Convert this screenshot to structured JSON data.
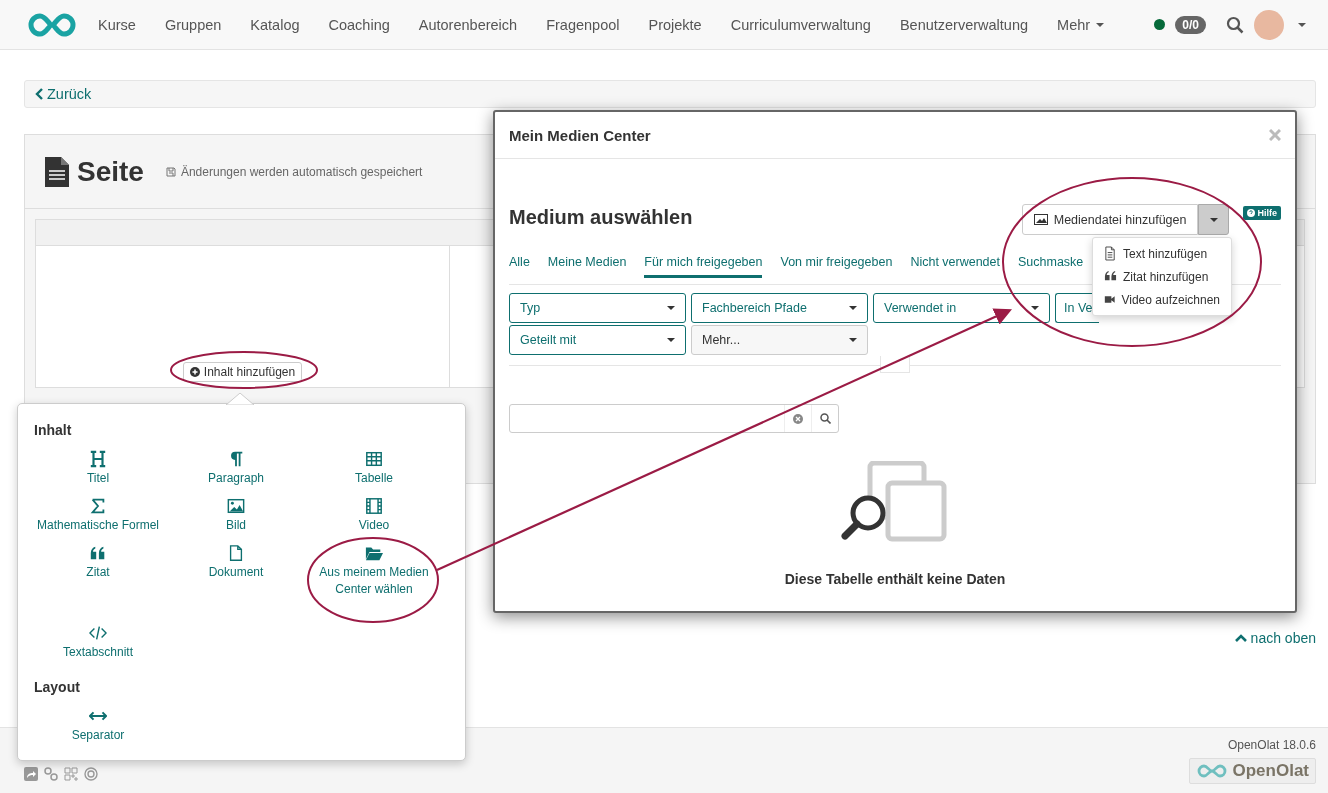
{
  "nav": {
    "items": [
      {
        "label": "Kurse",
        "kind": "link"
      },
      {
        "label": "Gruppen",
        "kind": "link"
      },
      {
        "label": "Katalog",
        "kind": "link"
      },
      {
        "label": "Coaching",
        "kind": "link"
      },
      {
        "label": "Autorenbereich",
        "kind": "link"
      },
      {
        "label": "Fragenpool",
        "kind": "link"
      },
      {
        "label": "Projekte",
        "kind": "link"
      },
      {
        "label": "Curriculumverwaltung",
        "kind": "link"
      },
      {
        "label": "Benutzerverwaltung",
        "kind": "link"
      },
      {
        "label": "Mehr",
        "kind": "menu"
      }
    ],
    "badge": "0/0"
  },
  "back": "Zurück",
  "page": {
    "title": "Seite",
    "autosave": "Änderungen werden automatisch gespeichert",
    "add_button": "Inhalt hinzufügen"
  },
  "popover": {
    "sections": [
      {
        "title": "Inhalt",
        "items": [
          {
            "label": "Titel"
          },
          {
            "label": "Paragraph"
          },
          {
            "label": "Tabelle"
          },
          {
            "label": "Mathematische Formel"
          },
          {
            "label": "Bild"
          },
          {
            "label": "Video"
          },
          {
            "label": "Zitat"
          },
          {
            "label": "Dokument"
          },
          {
            "label": "Aus meinem Medien Center wählen"
          },
          {
            "label": "Textabschnitt"
          }
        ]
      },
      {
        "title": "Layout",
        "items": [
          {
            "label": "Separator"
          }
        ]
      }
    ]
  },
  "modal": {
    "title": "Mein Medien Center",
    "heading": "Medium auswählen",
    "add_button": "Mediendatei hinzufügen",
    "help": "Hilfe",
    "menu": [
      {
        "label": "Text hinzufügen"
      },
      {
        "label": "Zitat hinzufügen"
      },
      {
        "label": "Video aufzeichnen"
      }
    ],
    "tabs": [
      {
        "label": "Alle",
        "selected": false
      },
      {
        "label": "Meine Medien",
        "selected": false
      },
      {
        "label": "Für mich freigegeben",
        "selected": true
      },
      {
        "label": "Von mir freigegeben",
        "selected": false
      },
      {
        "label": "Nicht verwendet",
        "selected": false
      },
      {
        "label": "Suchmaske",
        "selected": false
      }
    ],
    "filters": [
      {
        "label": "Typ",
        "kind": "filter"
      },
      {
        "label": "Fachbereich Pfade",
        "kind": "filter"
      },
      {
        "label": "Verwendet in",
        "kind": "filter"
      },
      {
        "label": "In Ve",
        "kind": "cut"
      },
      {
        "label": "Geteilt mit",
        "kind": "filter"
      },
      {
        "label": "Mehr...",
        "kind": "more"
      }
    ],
    "empty": "Diese Tabelle enthält keine Daten"
  },
  "top_link": "nach oben",
  "footer": {
    "version": "OpenOlat 18.0.6",
    "logo": "OpenOlat"
  }
}
